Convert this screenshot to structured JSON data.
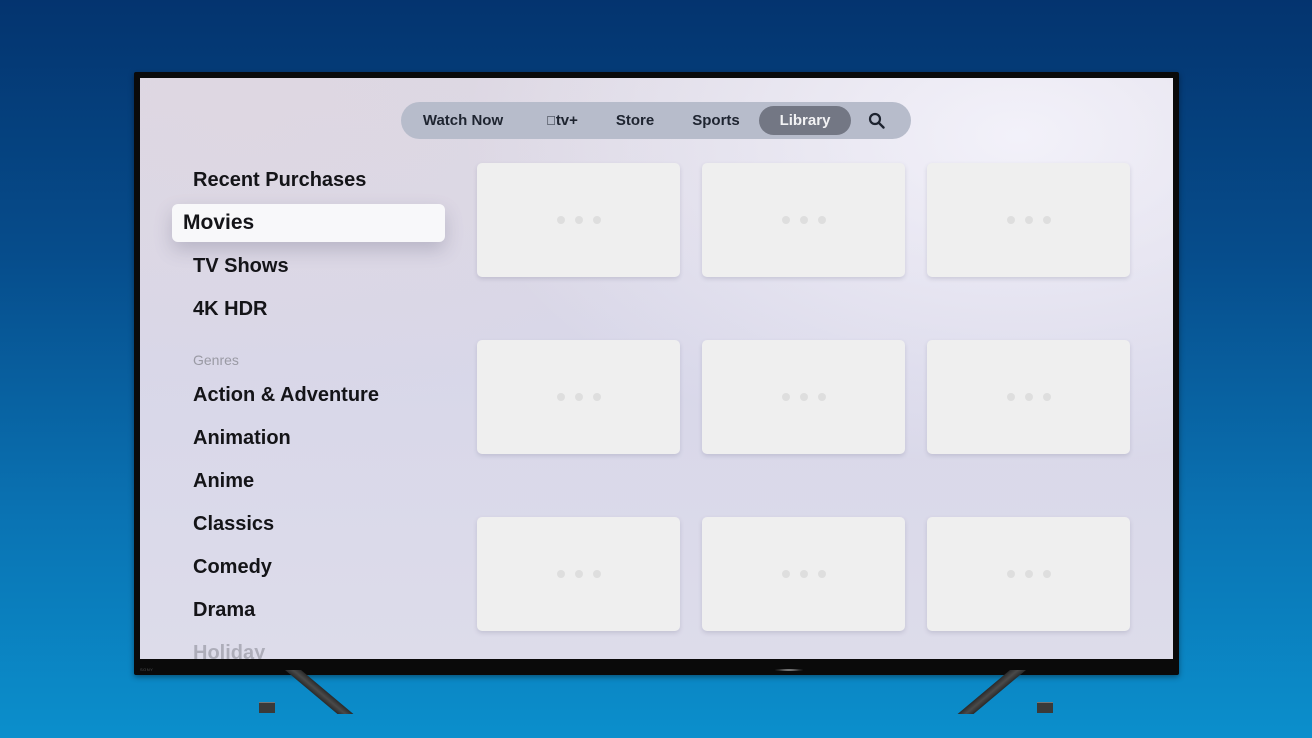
{
  "colors": {
    "background_top": "#04346f",
    "background_bottom": "#0b8fcc",
    "nav_bar": "#b7bccb",
    "nav_active": "#737784",
    "selected_item": "#f8f8fa",
    "card": "#efefef"
  },
  "tv": {
    "brand": "SONY"
  },
  "nav": {
    "items": [
      {
        "label": "Watch Now",
        "active": false
      },
      {
        "label": "tv+",
        "icon": "apple-logo-icon",
        "active": false
      },
      {
        "label": "Store",
        "active": false
      },
      {
        "label": "Sports",
        "active": false
      },
      {
        "label": "Library",
        "active": true
      }
    ],
    "search_icon": "search-icon"
  },
  "sidebar": {
    "items": [
      {
        "label": "Recent Purchases"
      },
      {
        "label": "Movies",
        "selected": true
      },
      {
        "label": "TV Shows"
      },
      {
        "label": "4K HDR"
      }
    ],
    "genres_header": "Genres",
    "genres": [
      {
        "label": "Action & Adventure"
      },
      {
        "label": "Animation"
      },
      {
        "label": "Anime"
      },
      {
        "label": "Classics"
      },
      {
        "label": "Comedy"
      },
      {
        "label": "Drama"
      },
      {
        "label": "Holiday"
      }
    ]
  },
  "grid": {
    "rows": 3,
    "cols": 3,
    "placeholder_icon": "loading-dots-icon"
  }
}
